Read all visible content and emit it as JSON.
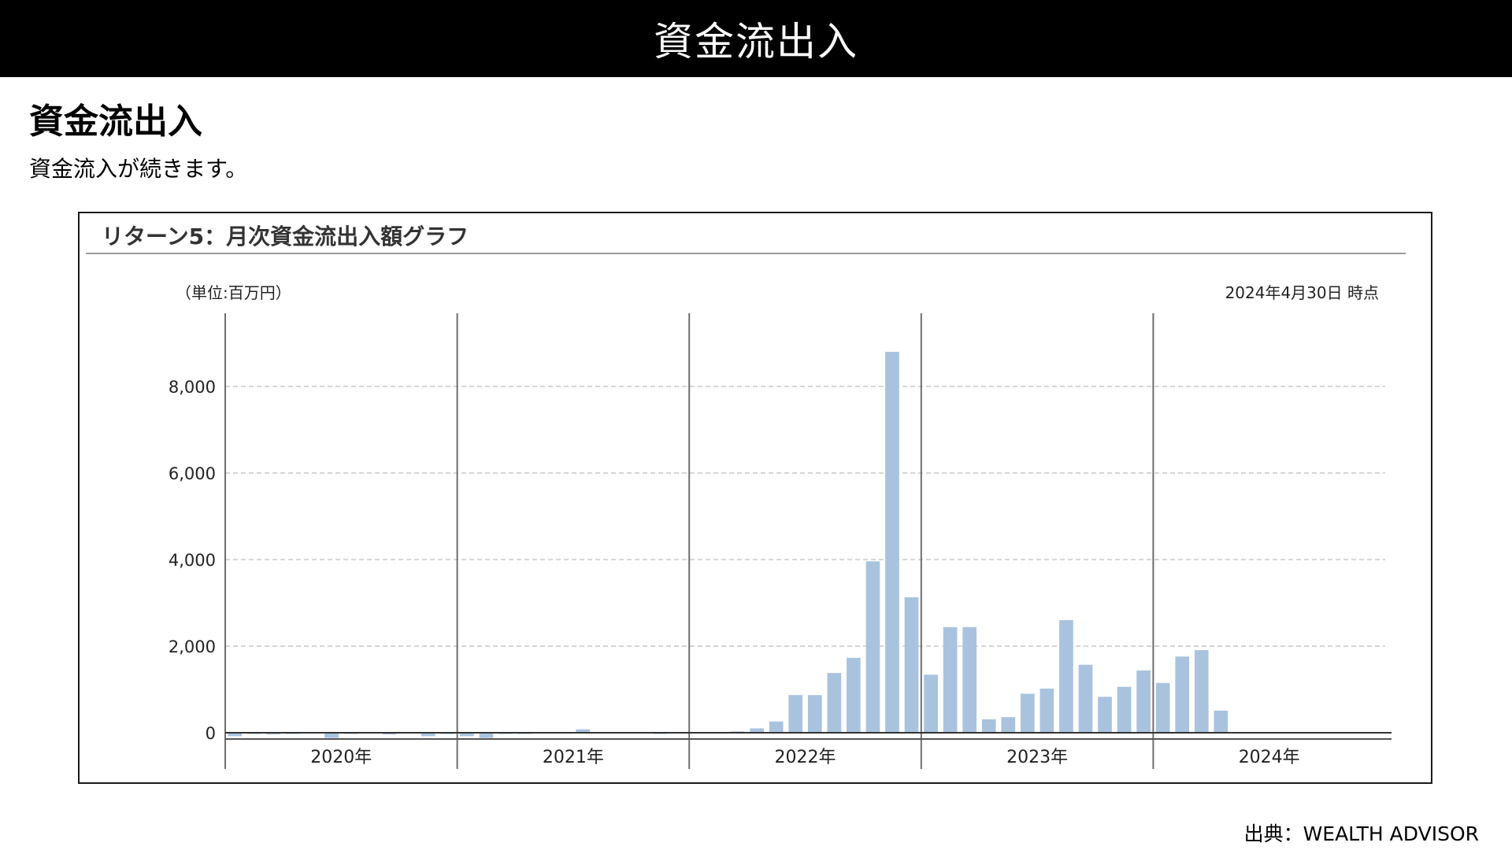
{
  "header": {
    "banner_title": "資金流出入"
  },
  "section": {
    "heading": "資金流出入",
    "subtitle": "資金流入が続きます。"
  },
  "chart_panel": {
    "title": "リターン5：月次資金流出入額グラフ",
    "unit_label": "（単位:百万円）",
    "as_of_label": "2024年4月30日 時点"
  },
  "source": {
    "label": "出典：WEALTH ADVISOR"
  },
  "colors": {
    "bar": "#a9c3de",
    "grid": "#c8c8c8",
    "axis": "#555555",
    "banner": "#000000"
  },
  "chart_data": {
    "type": "bar",
    "title": "リターン5：月次資金流出入額グラフ",
    "ylabel": "（単位:百万円）",
    "xlabel": "",
    "ylim": [
      -150,
      9000
    ],
    "yticks": [
      0,
      2000,
      4000,
      6000,
      8000
    ],
    "ytick_labels": [
      "0",
      "2,000",
      "4,000",
      "6,000",
      "8,000"
    ],
    "year_labels": [
      "2020年",
      "2021年",
      "2022年",
      "2023年",
      "2024年"
    ],
    "grid": "horizontal-dashed",
    "months": [
      "2020-01",
      "2020-02",
      "2020-03",
      "2020-04",
      "2020-05",
      "2020-06",
      "2020-07",
      "2020-08",
      "2020-09",
      "2020-10",
      "2020-11",
      "2020-12",
      "2021-01",
      "2021-02",
      "2021-03",
      "2021-04",
      "2021-05",
      "2021-06",
      "2021-07",
      "2021-08",
      "2021-09",
      "2021-10",
      "2021-11",
      "2021-12",
      "2022-01",
      "2022-02",
      "2022-03",
      "2022-04",
      "2022-05",
      "2022-06",
      "2022-07",
      "2022-08",
      "2022-09",
      "2022-10",
      "2022-11",
      "2022-12",
      "2023-01",
      "2023-02",
      "2023-03",
      "2023-04",
      "2023-05",
      "2023-06",
      "2023-07",
      "2023-08",
      "2023-09",
      "2023-10",
      "2023-11",
      "2023-12",
      "2024-01",
      "2024-02",
      "2024-03",
      "2024-04",
      "2024-05",
      "2024-06",
      "2024-07",
      "2024-08",
      "2024-09",
      "2024-10",
      "2024-11",
      "2024-12"
    ],
    "values": [
      -80,
      -30,
      -40,
      -30,
      0,
      -120,
      -30,
      0,
      -40,
      0,
      -80,
      -30,
      -80,
      -120,
      -30,
      -30,
      0,
      -20,
      80,
      0,
      0,
      0,
      -30,
      -20,
      0,
      0,
      30,
      100,
      260,
      870,
      870,
      1380,
      1730,
      3960,
      8800,
      3130,
      1340,
      2440,
      2440,
      310,
      360,
      900,
      1020,
      2600,
      1570,
      830,
      1060,
      1440,
      1150,
      1760,
      1910,
      510,
      0,
      0,
      0,
      0,
      0,
      0,
      0,
      0
    ]
  }
}
